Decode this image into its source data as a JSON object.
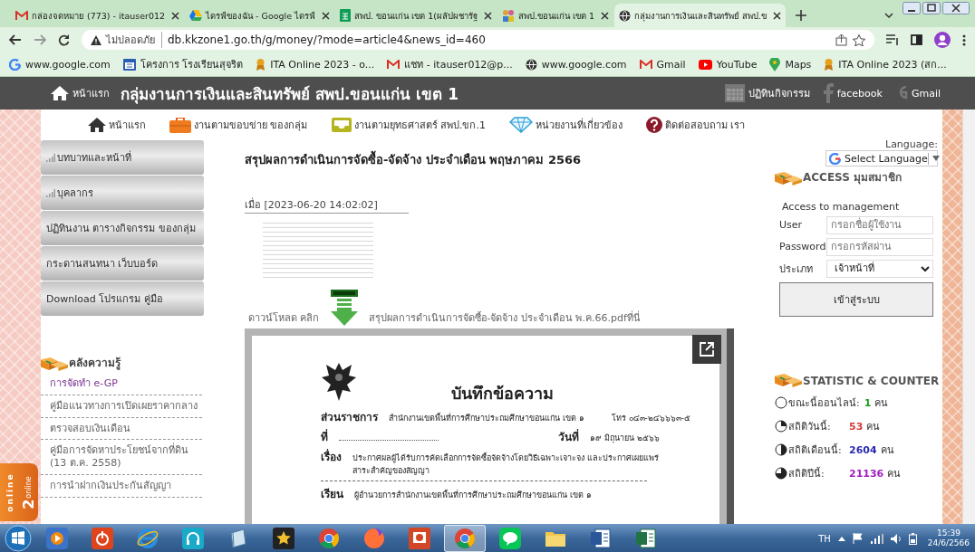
{
  "browser": {
    "tabs": [
      {
        "title": "กล่องจดหมาย (773) - itauser012",
        "kind": "mail",
        "selected": false
      },
      {
        "title": "ไดรฟ์ของฉัน - Google ไดรฟ์",
        "kind": "drive",
        "selected": false
      },
      {
        "title": "สพป. ขอนแก่น เขต 1(ผลัปผชารัฐ",
        "kind": "sheet",
        "selected": false
      },
      {
        "title": "สพป.ขอนแก่น เขต 1",
        "kind": "people",
        "selected": false
      },
      {
        "title": "กลุ่มงานการเงินและสินทรัพย์ สพป.ข",
        "kind": "globe",
        "selected": true
      }
    ],
    "address": {
      "security_label": "ไม่ปลอดภัย",
      "url": "db.kkzone1.go.th/g/money/?mode=article4&news_id=460"
    },
    "bookmarks": [
      {
        "label": "www.google.com",
        "kind": "google"
      },
      {
        "label": "โครงการ โรงเรียนสุจริต",
        "kind": "calendar"
      },
      {
        "label": "ITA Online 2023 - o...",
        "kind": "ita"
      },
      {
        "label": "แชท - itauser012@p...",
        "kind": "mail"
      },
      {
        "label": "www.google.com",
        "kind": "globe"
      },
      {
        "label": "Gmail",
        "kind": "mail"
      },
      {
        "label": "YouTube",
        "kind": "youtube"
      },
      {
        "label": "Maps",
        "kind": "maps"
      },
      {
        "label": "ITA Online 2023 (สก...",
        "kind": "ita"
      }
    ]
  },
  "site_header": {
    "home_label": "หน้าแรก",
    "title": "กลุ่มงานการเงินและสินทรัพย์ สพป.ขอนแก่น เขต 1",
    "links": [
      {
        "label": "ปฏิทินกิจกรรม",
        "kind": "calendar"
      },
      {
        "label": "facebook",
        "kind": "facebook"
      },
      {
        "label": "Gmail",
        "kind": "gplus"
      }
    ]
  },
  "nav": [
    {
      "label": "หน้าแรก",
      "kind": "home"
    },
    {
      "label": "งานตามขอบข่าย ของกลุ่ม",
      "kind": "briefcase"
    },
    {
      "label": "งานตามยุทธศาสตร์ สพป.ขก.1",
      "kind": "inbox"
    },
    {
      "label": "หน่วยงานที่เกี่ยวข้อง",
      "kind": "diamond"
    },
    {
      "label": "ติดต่อสอบถาม เรา",
      "kind": "help"
    }
  ],
  "sidebar": {
    "menu": [
      {
        "label": "บทบาทและหน้าที่",
        "kind": "bars"
      },
      {
        "label": "บุคลากร",
        "kind": "bars"
      },
      {
        "label": "ปฏิทินงาน ตารางกิจกรรม ของกลุ่ม",
        "kind": "plain"
      },
      {
        "label": "กระดานสนทนา เว็บบอร์ด",
        "kind": "plain"
      },
      {
        "label": "Download โปรแกรม คู่มือ",
        "kind": "plain"
      }
    ],
    "knowledge": {
      "heading": "คลังความรู้",
      "links": [
        {
          "label": "การจัดทำ e-GP",
          "visited": true
        },
        {
          "label": "คู่มือแนวทางการเปิดเผยราคากลาง",
          "visited": false
        },
        {
          "label": "ตรวจสอบเงินเดือน",
          "visited": false
        },
        {
          "label": "คู่มือการจัดหาประโยชน์จากที่ดิน (13 ต.ค. 2558)",
          "visited": false
        },
        {
          "label": "การนำฝากเงินประกันสัญญา",
          "visited": false
        }
      ]
    }
  },
  "online_badge": {
    "side_label": "online",
    "count": "2",
    "count_label": "online"
  },
  "article": {
    "title": "สรุปผลการดำเนินการจัดซื้อ-จัดจ้าง ประจำเดือน พฤษภาคม 2566",
    "posted": "เมื่อ [2023-06-20 14:02:02]",
    "download_label": "ดาวน์โหลด คลิก",
    "download_link": "สรุปผลการดำเนินการจัดซื้อ-จัดจ้าง ประจำเดือน พ.ค.66.pdfที่นี่",
    "document": {
      "heading": "บันทึกข้อความ",
      "agency_label": "ส่วนราชการ",
      "agency": "สำนักงานเขตพื้นที่การศึกษาประถมศึกษาขอนแก่น เขต ๑",
      "phone": "โทร ๐๔๓-๒๔๖๖๖๓-๕",
      "ref_label": "ที่",
      "date_label": "วันที่",
      "date": "๑๙ มิถุนายน ๒๕๖๖",
      "subject_label": "เรื่อง",
      "subject": "ประกาศผลผู้ได้รับการคัดเลือกการจัดซื้อจัดจ้างโดยวิธีเฉพาะเจาะจง และประกาศเผยแพร่ สาระสำคัญของสัญญา",
      "to_label": "เรียน",
      "to": "ผู้อำนวยการสำนักงานเขตพื้นที่การศึกษาประถมศึกษาขอนแก่น เขต ๑"
    }
  },
  "access": {
    "language_label": "Language:",
    "language_select": "Select Language",
    "heading": "ACCESS มุมสมาชิก",
    "subtitle": "Access to management",
    "user_label": "User",
    "user_placeholder": "กรอกชื่อผู้ใช้งาน",
    "password_label": "Password",
    "password_placeholder": "กรอกรหัสผ่าน",
    "type_label": "ประเภท",
    "type_value": "เจ้าหน้าที่",
    "login_button": "เข้าสู่ระบบ"
  },
  "stats": {
    "heading": "STATISTIC & COUNTER",
    "rows": [
      {
        "label": "ขณะนี้ออนไลน์:",
        "value": "1",
        "unit": "คน",
        "color": "#1f9a1f"
      },
      {
        "label": "สถิติวันนี้:",
        "value": "53",
        "unit": "คน",
        "color": "#d03a3a"
      },
      {
        "label": "สถิติเดือนนี้:",
        "value": "2604",
        "unit": "คน",
        "color": "#2a2ab4"
      },
      {
        "label": "สถิติปีนี้:",
        "value": "21136",
        "unit": "คน",
        "color": "#a020c0"
      }
    ]
  },
  "taskbar": {
    "apps": [
      {
        "kind": "media",
        "selected": false
      },
      {
        "kind": "power",
        "selected": false
      },
      {
        "kind": "ie",
        "selected": false
      },
      {
        "kind": "headset",
        "selected": false
      },
      {
        "kind": "notebook",
        "selected": false
      },
      {
        "kind": "star",
        "selected": false
      },
      {
        "kind": "chrome",
        "selected": false
      },
      {
        "kind": "firefox",
        "selected": false
      },
      {
        "kind": "slides",
        "selected": false
      },
      {
        "kind": "chrome",
        "selected": true
      },
      {
        "kind": "line",
        "selected": false
      },
      {
        "kind": "folder",
        "selected": false
      },
      {
        "kind": "word",
        "selected": false
      },
      {
        "kind": "excel",
        "selected": false
      }
    ],
    "tray": {
      "language": "TH",
      "time": "15:39",
      "date": "24/6/2566"
    }
  }
}
